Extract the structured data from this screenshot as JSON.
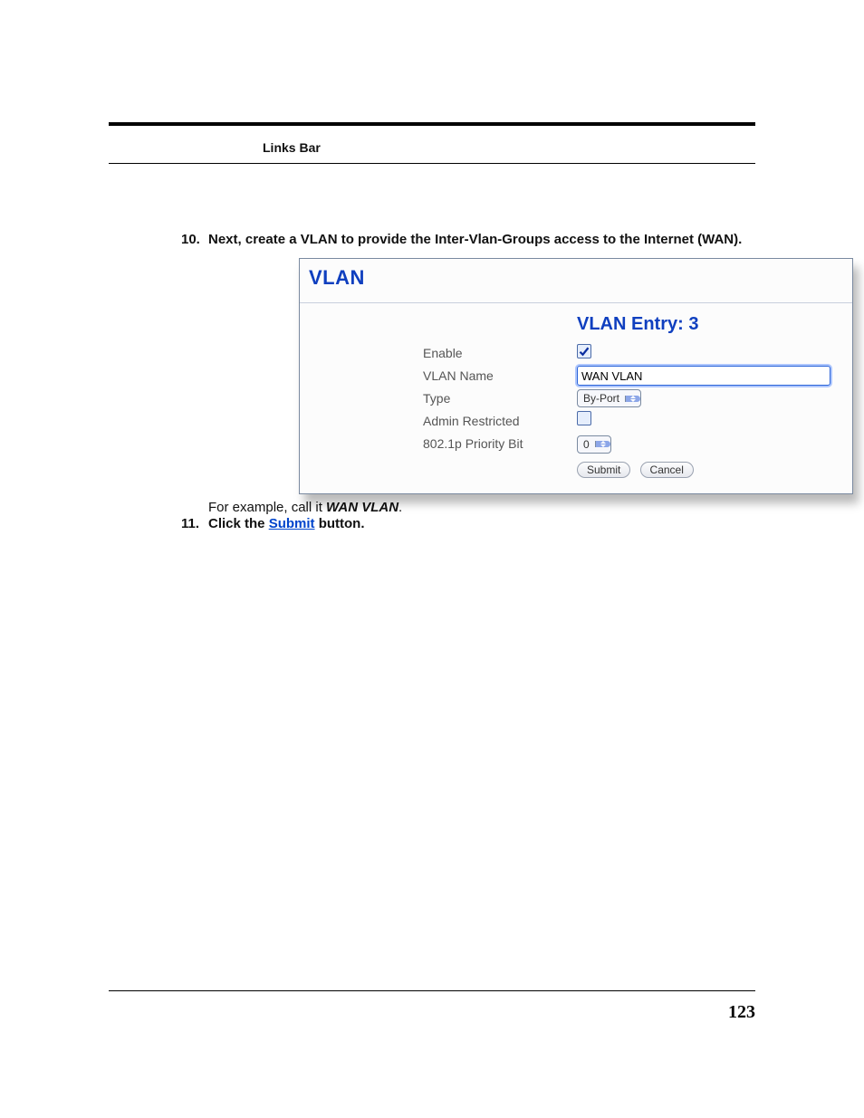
{
  "header": {
    "links_bar": "Links Bar"
  },
  "steps": {
    "s10": {
      "num": "10.",
      "text": "Next, create a VLAN to provide the Inter-Vlan-Groups access to the Internet (WAN)."
    },
    "note": {
      "prefix": "For example, call it ",
      "em": "WAN VLAN",
      "suffix": "."
    },
    "s11": {
      "num": "11.",
      "prefix": "Click the ",
      "link": "Submit",
      "suffix": " button."
    }
  },
  "panel": {
    "title": "VLAN",
    "entry_title": "VLAN Entry: 3",
    "labels": {
      "enable": "Enable",
      "vlan_name": "VLAN Name",
      "type": "Type",
      "admin_restricted": "Admin Restricted",
      "priority": "802.1p Priority Bit"
    },
    "values": {
      "enable_checked": true,
      "vlan_name": "WAN VLAN",
      "type": "By-Port",
      "admin_restricted_checked": false,
      "priority": "0"
    },
    "buttons": {
      "submit": "Submit",
      "cancel": "Cancel"
    }
  },
  "page_number": "123"
}
